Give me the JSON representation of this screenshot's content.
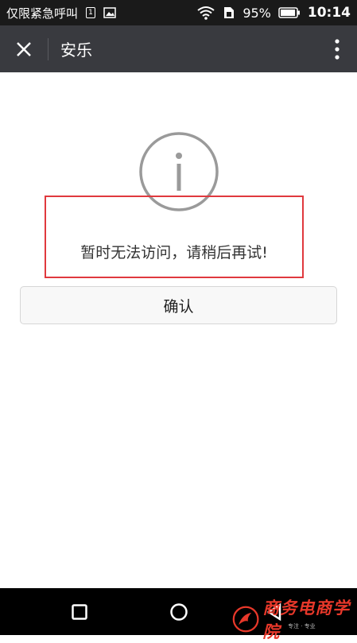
{
  "statusbar": {
    "carrier": "仅限紧急呼叫",
    "sim_label": "1",
    "battery_percent": "95%",
    "battery_level": 0.95,
    "time": "10:14"
  },
  "titlebar": {
    "title": "安乐"
  },
  "dialog": {
    "message": "暂时无法访问，请稍后再试!",
    "confirm_label": "确认"
  },
  "watermark": {
    "text": "商务电商学院",
    "subtext": "专注 · 专业"
  },
  "colors": {
    "statusbar_bg": "#1a1a1a",
    "titlebar_bg": "#393a3f",
    "highlight_border": "#e0393e",
    "watermark": "#e8382a"
  }
}
